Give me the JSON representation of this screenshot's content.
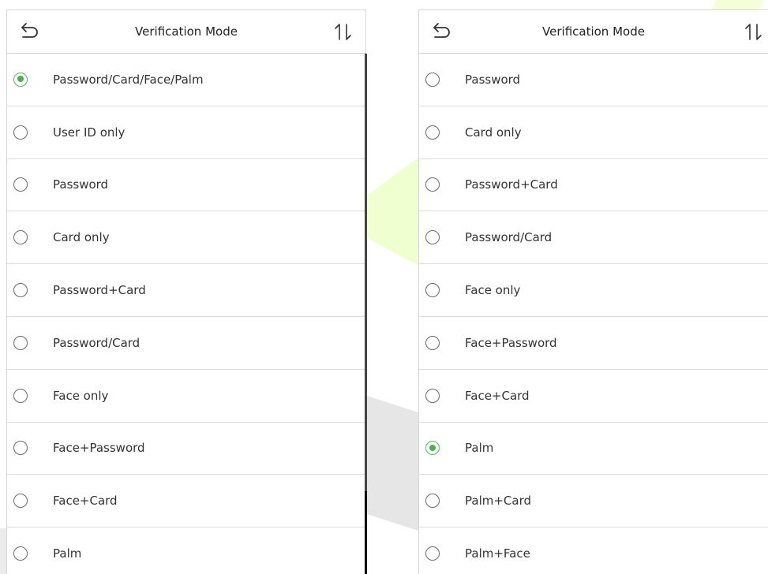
{
  "left_panel": {
    "title": "Verification Mode",
    "items": [
      {
        "label": "Password/Card/Face/Palm",
        "selected": true
      },
      {
        "label": "User ID only",
        "selected": false
      },
      {
        "label": "Password",
        "selected": false
      },
      {
        "label": "Card only",
        "selected": false
      },
      {
        "label": "Password+Card",
        "selected": false
      },
      {
        "label": "Password/Card",
        "selected": false
      },
      {
        "label": "Face only",
        "selected": false
      },
      {
        "label": "Face+Password",
        "selected": false
      },
      {
        "label": "Face+Card",
        "selected": false
      },
      {
        "label": "Palm",
        "selected": false
      }
    ]
  },
  "right_panel": {
    "title": "Verification Mode",
    "items": [
      {
        "label": "Password",
        "selected": false
      },
      {
        "label": "Card only",
        "selected": false
      },
      {
        "label": "Password+Card",
        "selected": false
      },
      {
        "label": "Password/Card",
        "selected": false
      },
      {
        "label": "Face only",
        "selected": false
      },
      {
        "label": "Face+Password",
        "selected": false
      },
      {
        "label": "Face+Card",
        "selected": false
      },
      {
        "label": "Palm",
        "selected": true
      },
      {
        "label": "Palm+Card",
        "selected": false
      },
      {
        "label": "Palm+Face",
        "selected": false
      }
    ]
  },
  "colors": {
    "selected_radio": "#4cb04c",
    "divider": "#dcdcdc"
  },
  "icons": {
    "back": "back-arrow-icon",
    "sort": "sort-arrows-icon"
  }
}
